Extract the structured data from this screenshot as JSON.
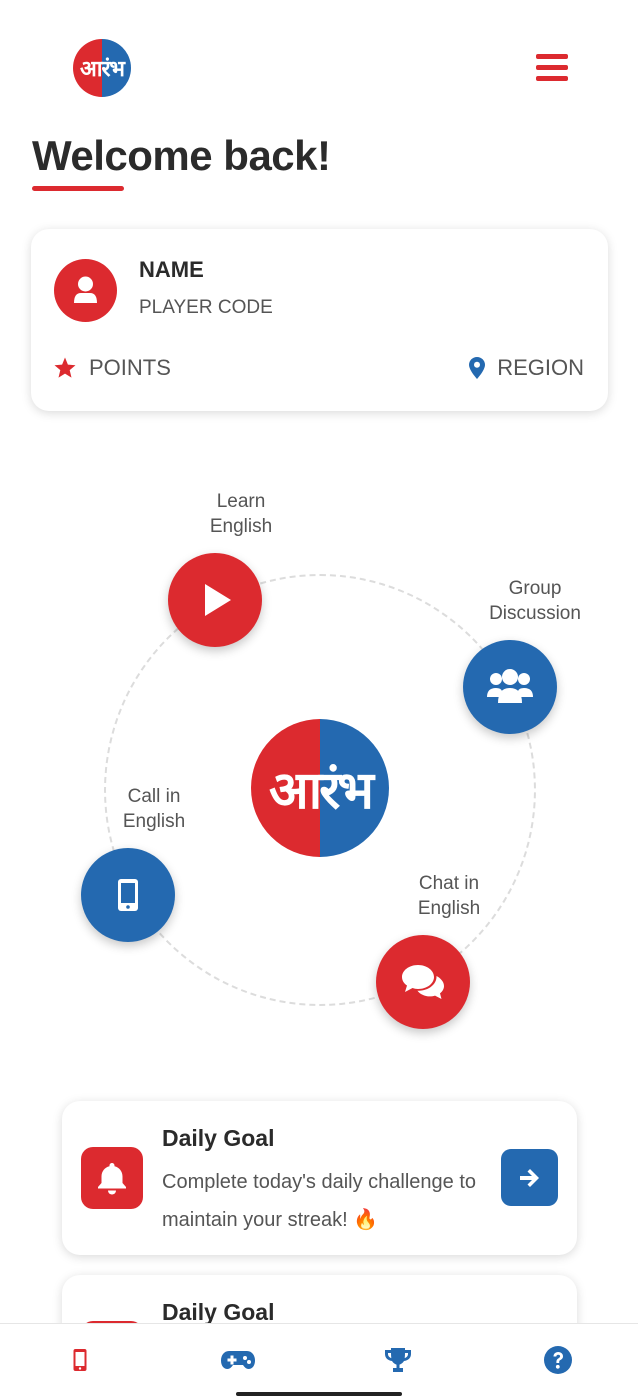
{
  "header": {
    "logo_text": "आरंभ",
    "menu_icon": "hamburger-menu-icon"
  },
  "page": {
    "title": "Welcome back!"
  },
  "profile": {
    "name": "NAME",
    "player_code": "PLAYER CODE",
    "points_label": "POINTS",
    "region_label": "REGION"
  },
  "features": {
    "center_logo_text": "आरंभ",
    "items": [
      {
        "label": "Learn\nEnglish",
        "icon": "play-icon",
        "color": "#dc2a2f"
      },
      {
        "label": "Group\nDiscussion",
        "icon": "users-icon",
        "color": "#2469b0"
      },
      {
        "label": "Call in\nEnglish",
        "icon": "mobile-phone-icon",
        "color": "#2469b0"
      },
      {
        "label": "Chat in\nEnglish",
        "icon": "chat-bubbles-icon",
        "color": "#dc2a2f"
      }
    ]
  },
  "goals": [
    {
      "title": "Daily Goal",
      "description": "Complete today's daily challenge to maintain your streak! 🔥"
    },
    {
      "title": "Daily Goal",
      "description": ""
    }
  ],
  "bottom_nav": {
    "items": [
      {
        "icon": "mobile-phone-icon",
        "active": true
      },
      {
        "icon": "gamepad-icon",
        "active": false
      },
      {
        "icon": "trophy-icon",
        "active": false
      },
      {
        "icon": "help-circle-icon",
        "active": false
      }
    ]
  },
  "colors": {
    "brand_red": "#dc2a2f",
    "brand_blue": "#2469b0",
    "text_dark": "#2b2b2b",
    "text_muted": "#555555"
  }
}
